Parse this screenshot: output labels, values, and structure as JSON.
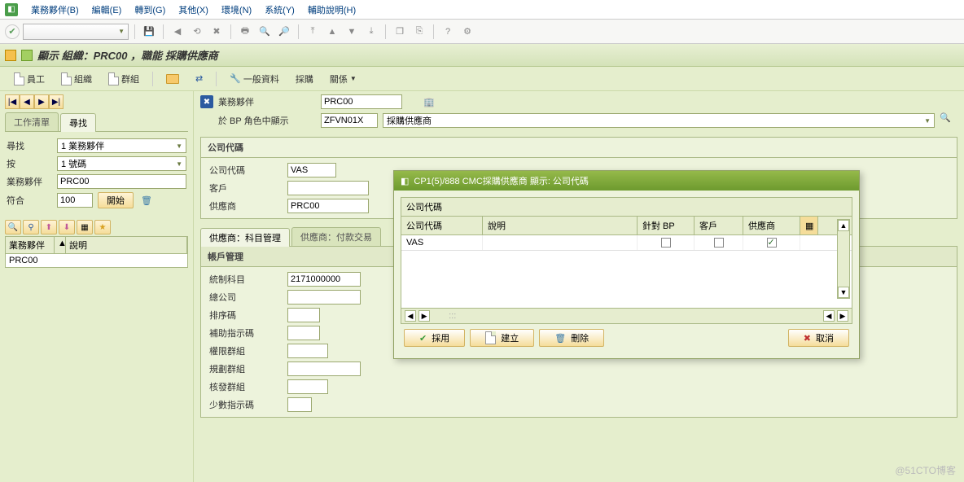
{
  "menu": {
    "items": [
      "業務夥伴(B)",
      "編輯(E)",
      "轉到(G)",
      "其他(X)",
      "環境(N)",
      "系統(Y)",
      "輔助說明(H)"
    ]
  },
  "title": "顯示 組織：PRC00        ，職能        採購供應商",
  "actionbar": {
    "emp": "員工",
    "org": "組織",
    "grp": "群組",
    "gen": "一般資料",
    "purch": "採購",
    "rel": "關係"
  },
  "left": {
    "tabs": {
      "worklist": "工作清單",
      "search": "尋找"
    },
    "searchLbl": "尋找",
    "search": "1 業務夥伴",
    "byLbl": "按",
    "by": "1 號碼",
    "bpLbl": "業務夥伴",
    "bp": "PRC00",
    "matchLbl": "符合",
    "match": "100",
    "start": "開始",
    "cols": {
      "bp": "業務夥伴",
      "desc": "說明"
    },
    "row": {
      "bp": "PRC00"
    }
  },
  "right": {
    "bpLbl": "業務夥伴",
    "bp": "PRC00",
    "roleLbl": "於 BP 角色中顯示",
    "roleCode": "ZFVN01X",
    "roleTxt": "採購供應商",
    "ccSection": "公司代碼",
    "ccLbl": "公司代碼",
    "cc": "VAS",
    "custLbl": "客戶",
    "vendLbl": "供應商",
    "vend": "PRC00",
    "subtabs": {
      "acct": "供應商：科目管理",
      "pay": "供應商：付款交易"
    },
    "acct": {
      "hdr": "帳戶管理",
      "recon": "統制科目",
      "reconVal": "2171000000",
      "hq": "總公司",
      "sort": "排序碼",
      "aux": "補助指示碼",
      "auth": "權限群組",
      "plan": "規劃群組",
      "rel": "核發群組",
      "min": "少數指示碼"
    }
  },
  "dialog": {
    "title": "CP1(5)/888 CMC採購供應商 顯示: 公司代碼",
    "section": "公司代碼",
    "cols": {
      "cc": "公司代碼",
      "desc": "說明",
      "forbp": "針對 BP",
      "cust": "客戶",
      "vend": "供應商"
    },
    "row": {
      "cc": "VAS",
      "forbp": false,
      "cust": false,
      "vend": true
    },
    "btns": {
      "adopt": "採用",
      "create": "建立",
      "delete": "刪除",
      "cancel": "取消"
    }
  },
  "watermark": "@51CTO博客"
}
